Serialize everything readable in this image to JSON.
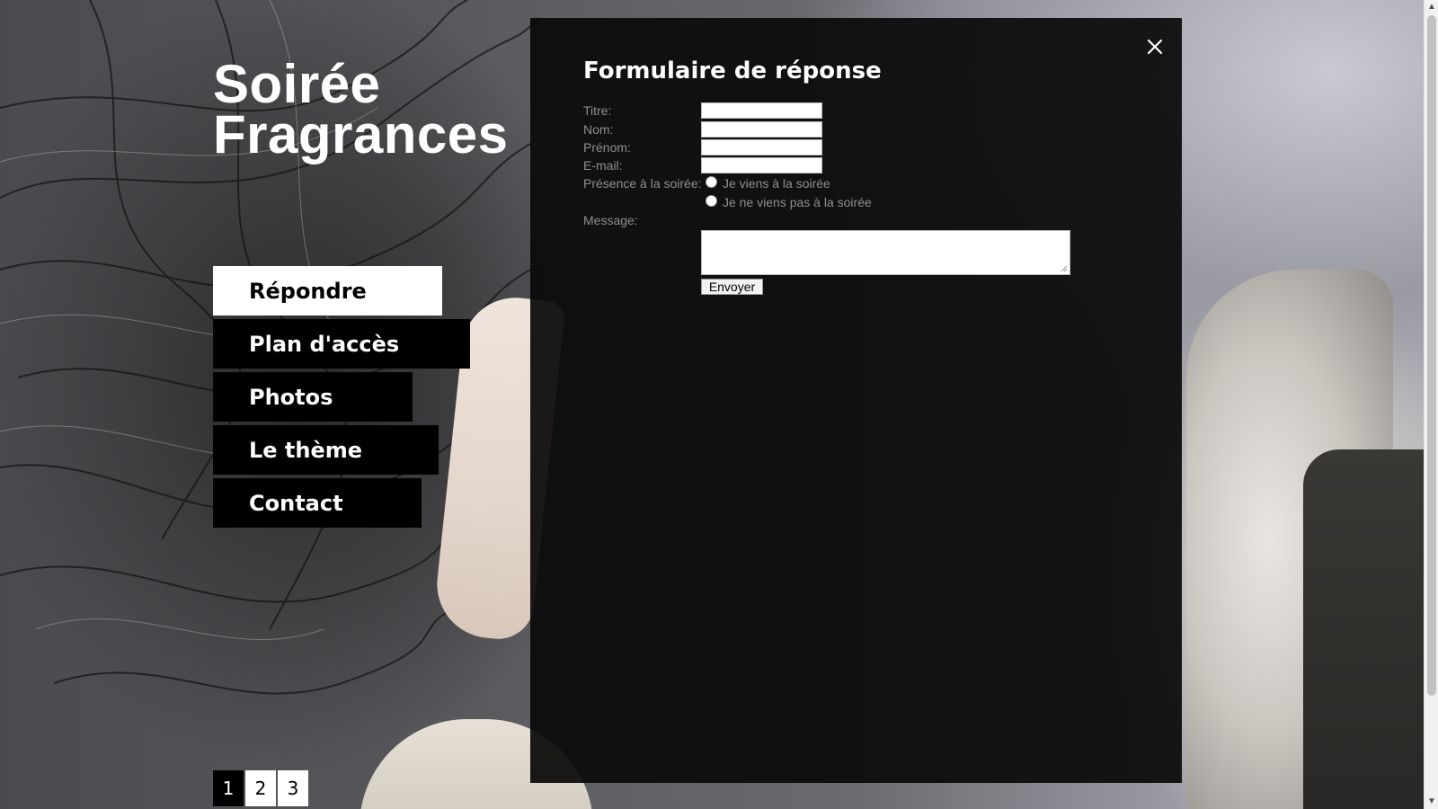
{
  "site": {
    "title_line1": "Soirée",
    "title_line2": "Fragrances"
  },
  "nav": {
    "items": [
      {
        "label": "Répondre",
        "active": true
      },
      {
        "label": "Plan d'accès"
      },
      {
        "label": "Photos"
      },
      {
        "label": "Le thème"
      },
      {
        "label": "Contact"
      }
    ]
  },
  "pager": {
    "pages": [
      "1",
      "2",
      "3"
    ],
    "current": "1"
  },
  "modal": {
    "title": "Formulaire de réponse",
    "fields": {
      "titre_label": "Titre:",
      "nom_label": "Nom:",
      "prenom_label": "Prénom:",
      "email_label": "E-mail:",
      "presence_label": "Présence à la soirée:",
      "radio_yes": "Je viens à la soirée",
      "radio_no": "Je ne viens pas à la soirée",
      "message_label": "Message:"
    },
    "submit_label": "Envoyer",
    "close_icon": "close-icon"
  },
  "scrollbar": {
    "up_glyph": "▲",
    "down_glyph": "▼"
  },
  "colors": {
    "modal_bg": "#0a0a0a",
    "nav_bg": "#000000",
    "nav_active_bg": "#ffffff",
    "label_gray": "#8f8f8f"
  }
}
